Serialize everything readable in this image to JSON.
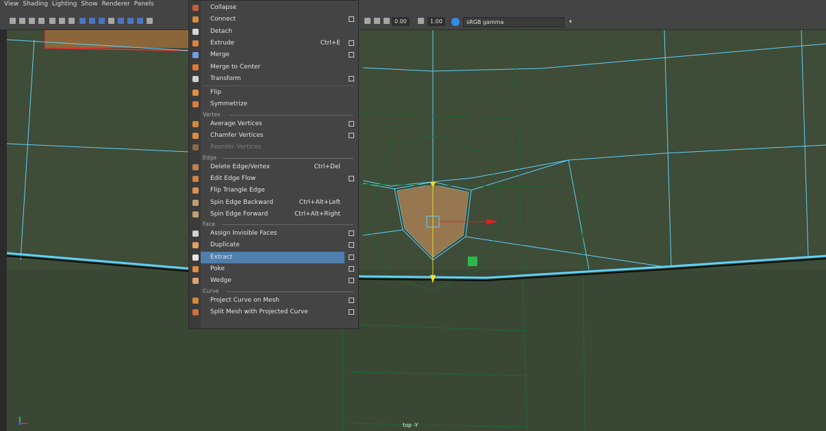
{
  "menubar": {
    "items": [
      "View",
      "Shading",
      "Lighting",
      "Show",
      "Renderer",
      "Panels"
    ]
  },
  "toolbar": {
    "value_a": "0.00",
    "value_b": "1.00",
    "color_space": "sRGB gamma"
  },
  "viewport": {
    "camera_label": "top -Y"
  },
  "context_menu": {
    "sections": [
      {
        "title": "",
        "items": [
          {
            "label": "Collapse",
            "shortcut": "",
            "option_box": false,
            "icon": "collapse-icon",
            "color": "#c85a3a"
          },
          {
            "label": "Connect",
            "shortcut": "",
            "option_box": true,
            "icon": "connect-icon",
            "color": "#d98a3a"
          },
          {
            "label": "Detach",
            "shortcut": "",
            "option_box": false,
            "icon": "detach-icon",
            "color": "#d7d7d7"
          },
          {
            "label": "Extrude",
            "shortcut": "Ctrl+E",
            "option_box": true,
            "icon": "extrude-icon",
            "color": "#e08040"
          },
          {
            "label": "Merge",
            "shortcut": "",
            "option_box": true,
            "icon": "merge-icon",
            "color": "#6aa0e0"
          },
          {
            "label": "Merge to Center",
            "shortcut": "",
            "option_box": false,
            "icon": "merge-center-icon",
            "color": "#e07a30"
          },
          {
            "label": "Transform",
            "shortcut": "",
            "option_box": true,
            "icon": "transform-icon",
            "color": "#d0d0d0"
          }
        ]
      },
      {
        "title": "",
        "items": [
          {
            "label": "Flip",
            "shortcut": "",
            "option_box": false,
            "icon": "flip-icon",
            "color": "#e09040"
          },
          {
            "label": "Symmetrize",
            "shortcut": "",
            "option_box": false,
            "icon": "symmetrize-icon",
            "color": "#e07a40"
          }
        ]
      },
      {
        "title": "Vertex",
        "items": [
          {
            "label": "Average Vertices",
            "shortcut": "",
            "option_box": true,
            "icon": "average-vertices-icon",
            "color": "#d08a3a"
          },
          {
            "label": "Chamfer Vertices",
            "shortcut": "",
            "option_box": true,
            "icon": "chamfer-vertices-icon",
            "color": "#e08a40"
          },
          {
            "label": "Reorder Vertices",
            "shortcut": "",
            "option_box": false,
            "icon": "reorder-vertices-icon",
            "color": "#8a6a4a",
            "disabled": true
          }
        ]
      },
      {
        "title": "Edge",
        "items": [
          {
            "label": "Delete Edge/Vertex",
            "shortcut": "Ctrl+Del",
            "option_box": false,
            "icon": "delete-edge-icon",
            "color": "#c08050"
          },
          {
            "label": "Edit Edge Flow",
            "shortcut": "",
            "option_box": true,
            "icon": "edge-flow-icon",
            "color": "#d08040"
          },
          {
            "label": "Flip Triangle Edge",
            "shortcut": "",
            "option_box": false,
            "icon": "flip-triangle-icon",
            "color": "#e09050"
          },
          {
            "label": "Spin Edge Backward",
            "shortcut": "Ctrl+Alt+Left",
            "option_box": false,
            "icon": "spin-backward-icon",
            "color": "#c0a070"
          },
          {
            "label": "Spin Edge Forward",
            "shortcut": "Ctrl+Alt+Right",
            "option_box": false,
            "icon": "spin-forward-icon",
            "color": "#c0a070"
          }
        ]
      },
      {
        "title": "Face",
        "items": [
          {
            "label": "Assign Invisible Faces",
            "shortcut": "",
            "option_box": true,
            "icon": "invisible-faces-icon",
            "color": "#d0d0d0"
          },
          {
            "label": "Duplicate",
            "shortcut": "",
            "option_box": true,
            "icon": "duplicate-icon",
            "color": "#e0a060"
          },
          {
            "label": "Extract",
            "shortcut": "",
            "option_box": true,
            "icon": "extract-icon",
            "color": "#e6e6e6",
            "highlight": true
          },
          {
            "label": "Poke",
            "shortcut": "",
            "option_box": true,
            "icon": "poke-icon",
            "color": "#e08a40"
          },
          {
            "label": "Wedge",
            "shortcut": "",
            "option_box": true,
            "icon": "wedge-icon",
            "color": "#e0a070"
          }
        ]
      },
      {
        "title": "Curve",
        "items": [
          {
            "label": "Project Curve on Mesh",
            "shortcut": "",
            "option_box": true,
            "icon": "project-curve-icon",
            "color": "#d08a3a"
          },
          {
            "label": "Split Mesh with Projected Curve",
            "shortcut": "",
            "option_box": true,
            "icon": "split-mesh-icon",
            "color": "#d0703a"
          }
        ]
      }
    ]
  }
}
